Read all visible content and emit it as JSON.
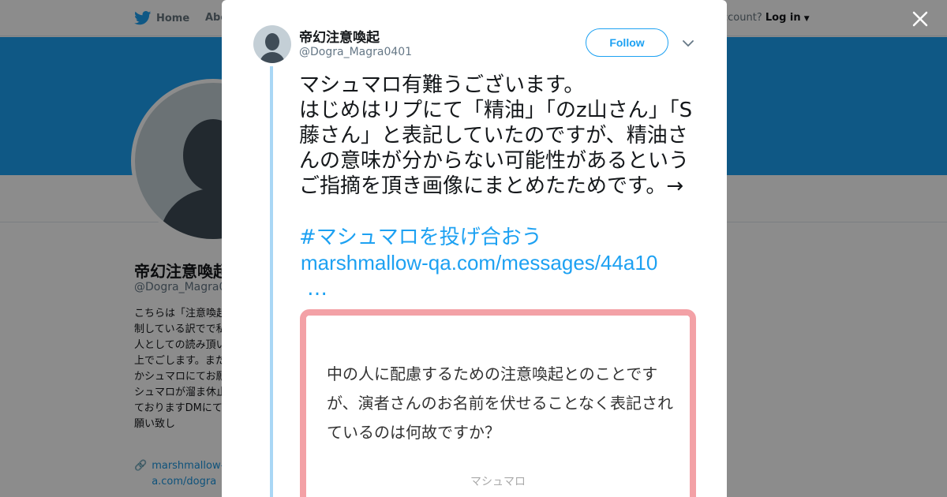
{
  "background": {
    "nav": {
      "home": "Home",
      "about": "Abo",
      "account_prefix": "ccount?",
      "login": "Log in"
    },
    "profile": {
      "name": "帝幻注意喚起",
      "handle": "@Dogra_Magra04",
      "bio": "こちらは「注意喚起強制している訳でで私個人としての読み頂いた上でごします。また何かシュマロにてお願マシュマロが溜ま休止しておりますDMにてお願い致し",
      "link": "marshmallow-qa.com/dogra"
    }
  },
  "modal": {
    "close_icon": "close-icon",
    "user": {
      "name": "帝幻注意喚起",
      "handle": "@Dogra_Magra0401"
    },
    "follow_label": "Follow",
    "tweet": {
      "text": "マシュマロ有難うございます。\nはじめはリプにて「精油」「のz山さん」「S藤さん」と表記していたのですが、精油さんの意味が分からない可能性があるというご指摘を頂き画像にまとめたためです。→",
      "hashtag": "#マシュマロを投げ合おう",
      "link": "marshmallow-qa.com/messages/44a10",
      "ellipsis": "…"
    },
    "card": {
      "question": "中の人に配慮するための注意喚起とのことですが、演者さんのお名前を伏せることなく表記されているのは何故ですか？",
      "label": "マシュマロ"
    }
  },
  "colors": {
    "accent": "#1da1f2",
    "banner": "#1da1f2",
    "card_border": "#f3a1a6",
    "thread_line": "#a9d7f5"
  }
}
